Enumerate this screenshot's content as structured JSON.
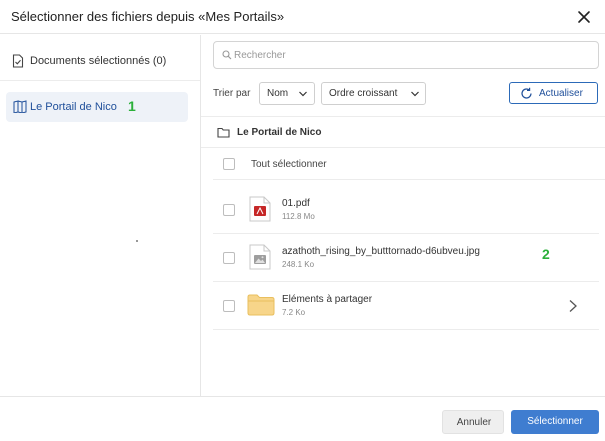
{
  "dialog": {
    "title": "Sélectionner des fichiers depuis «Mes Portails»",
    "close_icon": "close-icon"
  },
  "sidebar": {
    "selected_docs_label": "Documents sélectionnés (0)",
    "portal_label": "Le Portail de Nico",
    "portal_annotation": "1"
  },
  "search": {
    "placeholder": "Rechercher",
    "value": ""
  },
  "sort": {
    "label": "Trier par",
    "field_value": "Nom",
    "order_value": "Ordre croissant"
  },
  "refresh": {
    "label": "Actualiser"
  },
  "breadcrumb": {
    "label": "Le Portail de Nico"
  },
  "select_all": {
    "label": "Tout sélectionner"
  },
  "files": [
    {
      "name": "01.pdf",
      "size": "112.8 Mo",
      "type": "pdf"
    },
    {
      "name": "azathoth_rising_by_butttornado-d6ubveu.jpg",
      "size": "248.1 Ko",
      "type": "image",
      "annotation": "2"
    },
    {
      "name": "Eléments à partager",
      "size": "7.2 Ko",
      "type": "folder"
    }
  ],
  "footer": {
    "cancel_label": "Annuler",
    "select_label": "Sélectionner"
  },
  "colors": {
    "accent": "#3f7dd0",
    "link": "#1f4f9a",
    "annotation": "#2bb03a",
    "pdf": "#c62828",
    "folder": "#f7d58a"
  }
}
